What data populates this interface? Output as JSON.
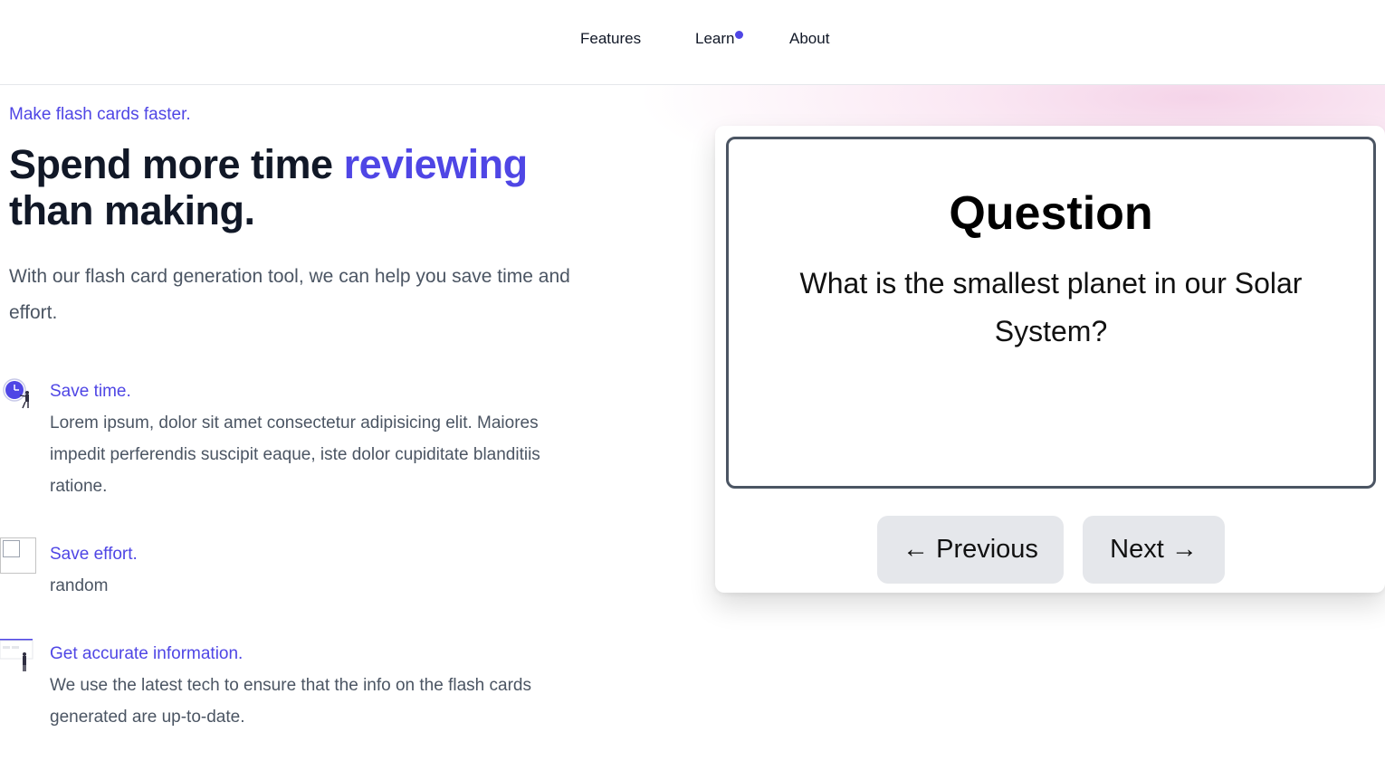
{
  "nav": {
    "items": [
      {
        "label": "Features"
      },
      {
        "label": "Learn",
        "has_notification_dot": true
      },
      {
        "label": "About"
      }
    ],
    "accent": "#4f46e5"
  },
  "hero": {
    "eyebrow": "Make flash cards faster.",
    "headline_part1": "Spend more time ",
    "headline_accent": "reviewing",
    "headline_part2": "than making.",
    "lead": "With our flash card generation tool, we can help you save time and effort."
  },
  "features": [
    {
      "icon": "clock-person-icon",
      "title": "Save time.",
      "desc": "Lorem ipsum, dolor sit amet consectetur adipisicing elit. Maiores impedit perferendis suscipit eaque, iste dolor cupiditate blanditiis ratione."
    },
    {
      "icon": "broken-image-icon",
      "title": "Save effort.",
      "desc": "random"
    },
    {
      "icon": "person-at-board-icon",
      "title": "Get accurate information.",
      "desc": "We use the latest tech to ensure that the info on the flash cards generated are up-to-date."
    }
  ],
  "flashcard": {
    "heading": "Question",
    "text": "What is the smallest planet in our Solar System?",
    "prev_label": "← Previous",
    "next_label": "Next →"
  },
  "colors": {
    "accent": "#4f46e5",
    "text_dark": "#111827",
    "text_muted": "#4b5563",
    "button_bg": "#e5e7eb",
    "card_border": "#4b5563"
  }
}
